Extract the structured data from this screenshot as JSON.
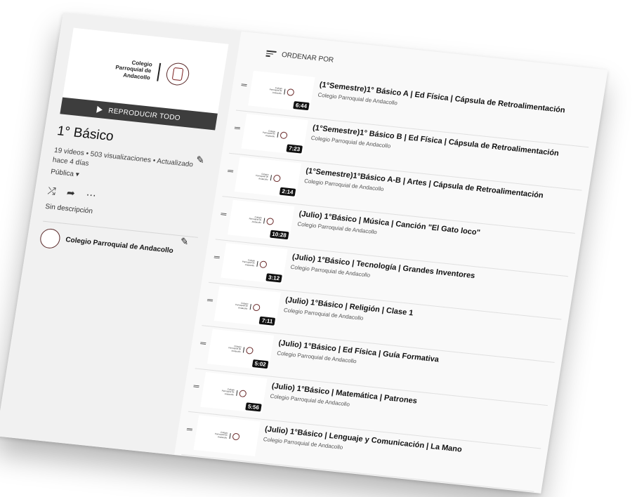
{
  "playlist": {
    "thumbnail_brand": "Colegio Parroquial de Andacollo",
    "play_all_label": "REPRODUCIR TODO",
    "title": "1° Básico",
    "meta": "19 videos • 503 visualizaciones • Actualizado hace 4 días",
    "privacy": "Pública",
    "description": "Sin descripción",
    "owner": "Colegio Parroquial de Andacollo"
  },
  "sort_label": "ORDENAR POR",
  "videos": [
    {
      "title": "(1°Semestre)1° Básico A | Ed Física | Cápsula de Retroalimentación",
      "channel": "Colegio Parroquial de Andacollo",
      "duration": "6:44"
    },
    {
      "title": "(1°Semestre)1° Básico B | Ed Física | Cápsula de Retroalimentación",
      "channel": "Colegio Parroquial de Andacollo",
      "duration": "7:23"
    },
    {
      "title": "(1°Semestre)1°Básico A-B | Artes | Cápsula de Retroalimentación",
      "channel": "Colegio Parroquial de Andacollo",
      "duration": "2:14"
    },
    {
      "title": "(Julio) 1°Básico | Música | Canción \"El Gato loco\"",
      "channel": "Colegio Parroquial de Andacollo",
      "duration": "10:28"
    },
    {
      "title": "(Julio) 1°Básico | Tecnología | Grandes Inventores",
      "channel": "Colegio Parroquial de Andacollo",
      "duration": "3:12"
    },
    {
      "title": "(Julio) 1°Básico | Religión | Clase 1",
      "channel": "Colegio Parroquial de Andacollo",
      "duration": "7:11"
    },
    {
      "title": "(Julio) 1°Básico | Ed Física | Guía Formativa",
      "channel": "Colegio Parroquial de Andacollo",
      "duration": "5:02"
    },
    {
      "title": "(Julio) 1°Básico | Matemática | Patrones",
      "channel": "Colegio Parroquial de Andacollo",
      "duration": "5:56"
    },
    {
      "title": "(Julio) 1°Básico | Lenguaje y Comunicación | La Mano",
      "channel": "Colegio Parroquial de Andacollo",
      "duration": ""
    }
  ]
}
